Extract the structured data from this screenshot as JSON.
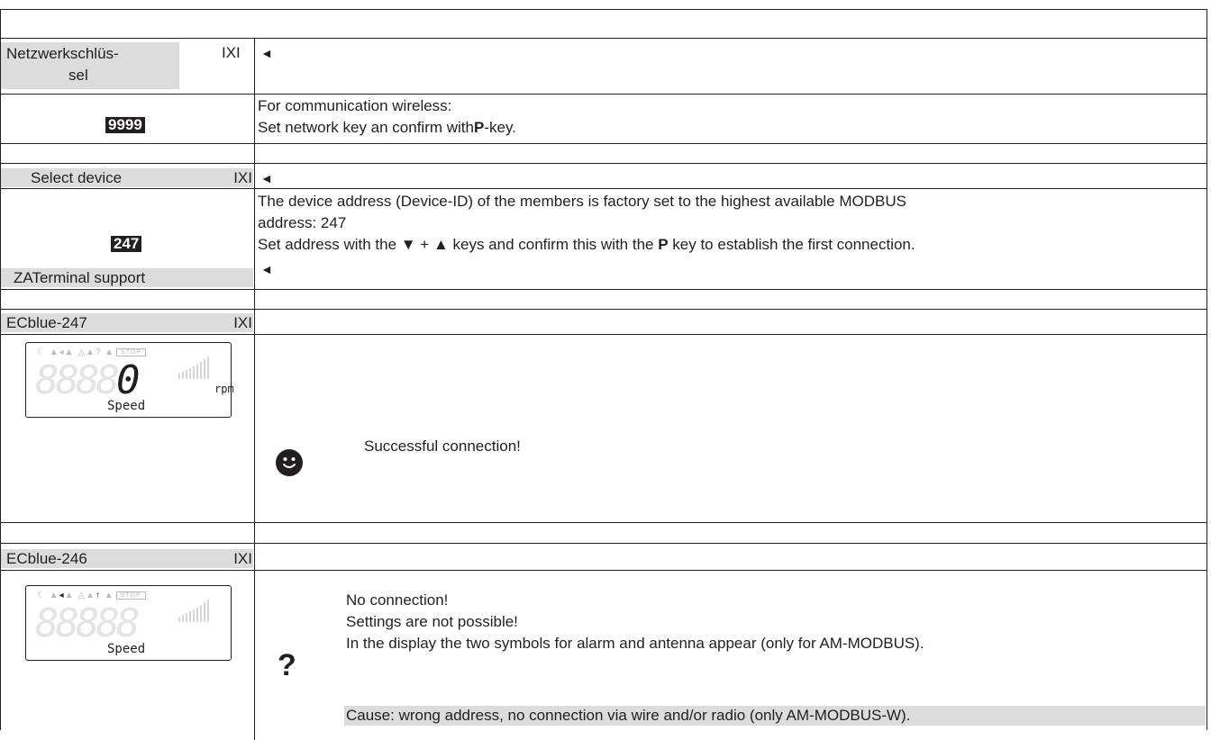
{
  "sections": {
    "network_key": {
      "menu_label_line1": "Netzwerkschlüs-",
      "menu_label_line2": "sel",
      "ixi": "IXI",
      "arrow": "◄",
      "value": "9999",
      "desc_line1": "For communication wireless:",
      "desc_line2_pre": "Set network key an confirm with",
      "desc_line2_key": "P",
      "desc_line2_post": "-key."
    },
    "select_device": {
      "menu_label": "Select device",
      "ixi": "IXI",
      "arrow": "◄",
      "value": "247",
      "desc_line1": "The device address (Device-ID) of the members is factory set to the highest available MODBUS",
      "desc_line2": "address: 247",
      "desc_line3_pre": "Set address with the ▼ + ▲ keys and confirm this with the ",
      "desc_line3_key": "P",
      "desc_line3_post": " key to establish the first connection."
    },
    "zaterminal": {
      "menu_label": "ZATerminal support",
      "arrow": "◄"
    },
    "ecblue_247": {
      "menu_label": "ECblue-247",
      "ixi": "IXI",
      "display": {
        "digits_off": "8888",
        "digit_on": "0",
        "unit": "rpm",
        "label": "Speed",
        "stop": "STOP"
      },
      "status_icon": "smiley-icon",
      "message": "Successful connection!"
    },
    "ecblue_246": {
      "menu_label": "ECblue-246",
      "ixi": "IXI",
      "display": {
        "digits_off": "88888",
        "label": "Speed",
        "stop": "STOP"
      },
      "status_icon": "question-mark-icon",
      "question": "?",
      "message_line1": "No connection!",
      "message_line2": "Settings are not possible!",
      "message_line3": "In the display the two symbols for alarm and antenna appear (only for AM-MODBUS).",
      "cause": "Cause: wrong address, no connection via wire and/or radio (only AM-MODBUS-W)."
    }
  }
}
